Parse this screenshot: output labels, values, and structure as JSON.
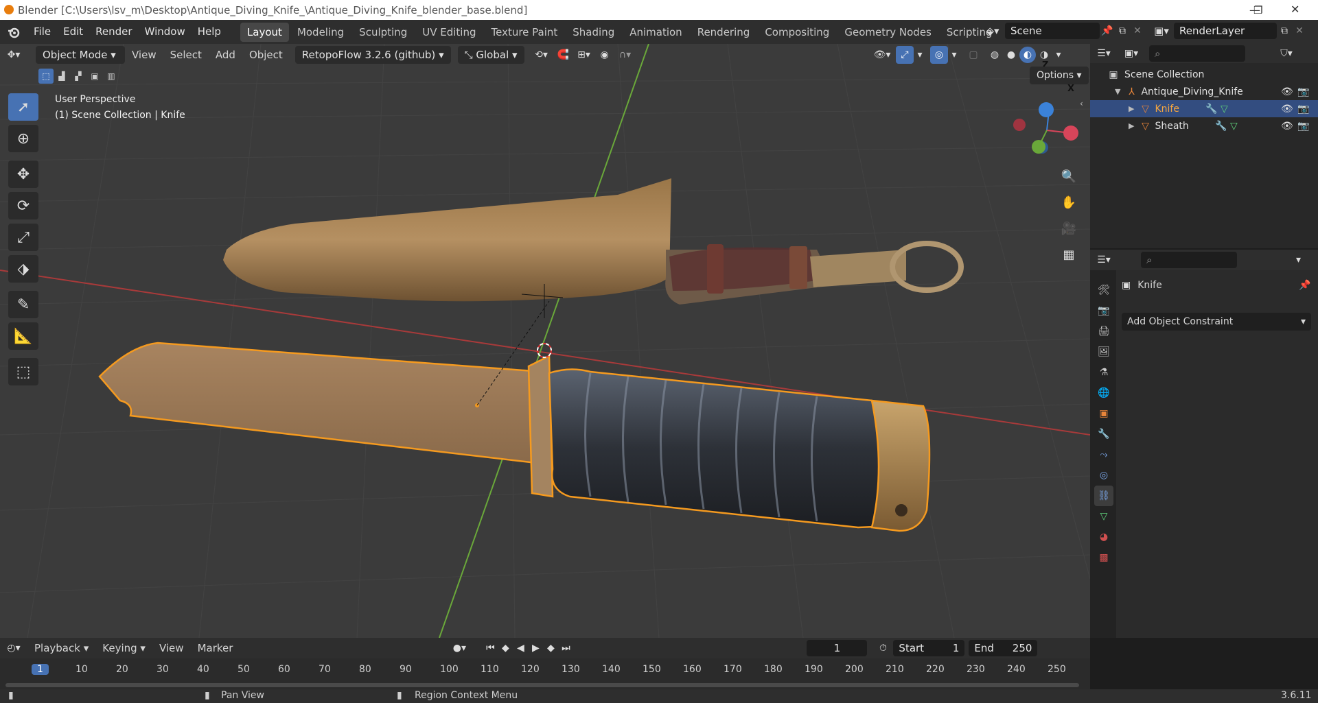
{
  "window": {
    "title": "Blender [C:\\Users\\lsv_m\\Desktop\\Antique_Diving_Knife_\\Antique_Diving_Knife_blender_base.blend]",
    "minimize": "—",
    "maximize": "❐",
    "close": "✕"
  },
  "menus": [
    "File",
    "Edit",
    "Render",
    "Window",
    "Help"
  ],
  "workspaces": [
    "Layout",
    "Modeling",
    "Sculpting",
    "UV Editing",
    "Texture Paint",
    "Shading",
    "Animation",
    "Rendering",
    "Compositing",
    "Geometry Nodes",
    "Scripting"
  ],
  "active_workspace": "Layout",
  "add_workspace": "+",
  "scene": {
    "name": "Scene"
  },
  "view_layer": {
    "name": "RenderLayer"
  },
  "viewport_header": {
    "mode": "Object Mode",
    "view": "View",
    "select": "Select",
    "add": "Add",
    "object": "Object",
    "addon": "RetopoFlow 3.2.6 (github)",
    "orientation": "Global"
  },
  "viewport": {
    "perspective_label": "User Perspective",
    "collection_label": "(1) Scene Collection | Knife",
    "options": "Options",
    "gizmo": {
      "z": "Z",
      "x": "X"
    }
  },
  "outliner": {
    "root": "Scene Collection",
    "items": [
      {
        "name": "Antique_Diving_Knife",
        "level": 1,
        "selected": false
      },
      {
        "name": "Knife",
        "level": 2,
        "selected": true
      },
      {
        "name": "Sheath",
        "level": 2,
        "selected": false
      }
    ]
  },
  "properties": {
    "object_name": "Knife",
    "add_constraint": "Add Object Constraint"
  },
  "timeline": {
    "playback": "Playback",
    "keying": "Keying",
    "view": "View",
    "marker": "Marker",
    "current_frame": "1",
    "start_label": "Start",
    "start": "1",
    "end_label": "End",
    "end": "250",
    "ticks": [
      "1",
      "10",
      "20",
      "30",
      "40",
      "50",
      "60",
      "70",
      "80",
      "90",
      "100",
      "110",
      "120",
      "130",
      "140",
      "150",
      "160",
      "170",
      "180",
      "190",
      "200",
      "210",
      "220",
      "230",
      "240",
      "250"
    ]
  },
  "statusbar": {
    "pan": "Pan View",
    "context": "Region Context Menu",
    "version": "3.6.11"
  },
  "colors": {
    "accent": "#4772b3",
    "selection_outline": "#f59a1f",
    "axis_x": "#b03a3a",
    "axis_y": "#6aa83a"
  }
}
